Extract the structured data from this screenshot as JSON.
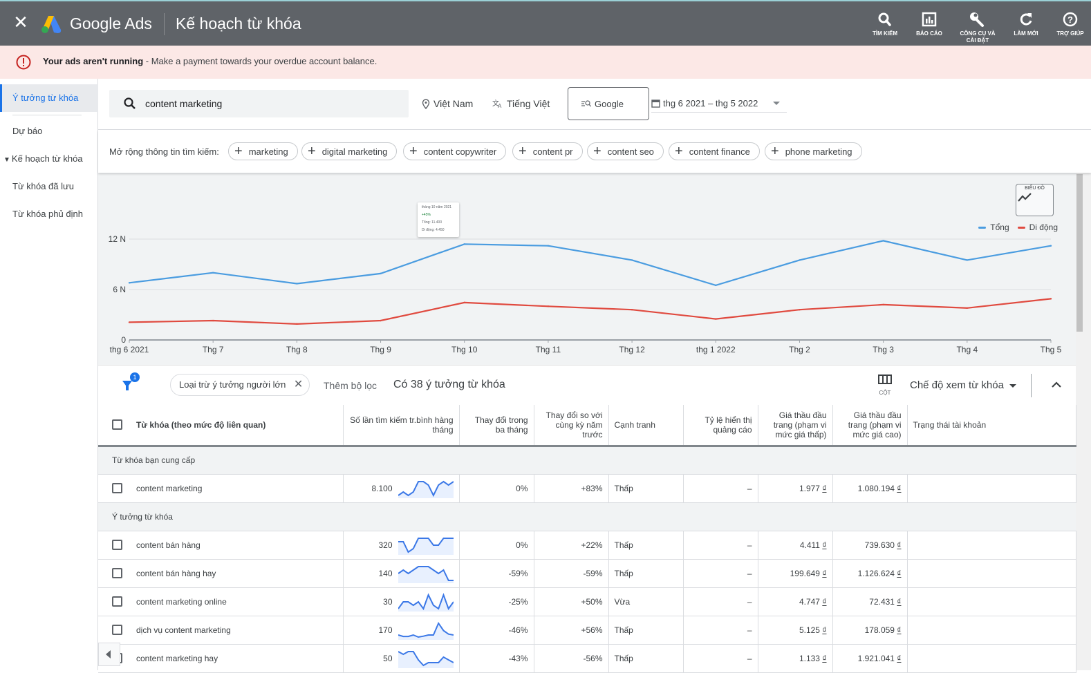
{
  "header": {
    "brand": "Google Ads",
    "title": "Kế hoạch từ khóa",
    "tools": [
      {
        "icon": "search-icon",
        "label": "TÌM KIẾM"
      },
      {
        "icon": "report-icon",
        "label": "BÁO CÁO"
      },
      {
        "icon": "wrench-icon",
        "label": "CÔNG CỤ VÀ CÀI ĐẶT"
      },
      {
        "icon": "refresh-icon",
        "label": "LÀM MỚI"
      },
      {
        "icon": "help-icon",
        "label": "TRỢ GIÚP"
      }
    ]
  },
  "alert": {
    "bold": "Your ads aren't running",
    "text": " - Make a payment towards your overdue account balance.",
    "color": "#c5221f"
  },
  "sidebar": {
    "items": [
      {
        "label": "Ý tưởng từ khóa",
        "active": true
      },
      {
        "label": "Dự báo"
      },
      {
        "label": "Kế hoạch từ khóa",
        "expandable": true
      },
      {
        "label": "Từ khóa đã lưu"
      },
      {
        "label": "Từ khóa phủ định"
      }
    ]
  },
  "search": {
    "value": "content marketing",
    "location": "Việt Nam",
    "language": "Tiếng Việt",
    "network": "Google",
    "date_range": "thg 6 2021 – thg 5 2022"
  },
  "refine": {
    "label": "Mở rộng thông tin tìm kiếm:",
    "chips": [
      "marketing",
      "digital marketing",
      "content copywriter",
      "content pr",
      "content seo",
      "content finance",
      "phone marketing"
    ]
  },
  "chart_toggle": {
    "label": "BIỂU ĐỒ"
  },
  "tooltip": {
    "title": "tháng 10 năm 2021",
    "change": "+45%",
    "total": "Tổng: 11.400",
    "mobile": "Di động: 4.450"
  },
  "chart_data": {
    "type": "line",
    "title": "",
    "xlabel": "",
    "ylabel": "",
    "categories": [
      "thg 6 2021",
      "Thg 7",
      "Thg 8",
      "Thg 9",
      "Thg 10",
      "Thg 11",
      "Thg 12",
      "thg 1 2022",
      "Thg 2",
      "Thg 3",
      "Thg 4",
      "Thg 5"
    ],
    "yticks": [
      {
        "value": 0,
        "label": "0"
      },
      {
        "value": 6000,
        "label": "6 N"
      },
      {
        "value": 12000,
        "label": "12 N"
      }
    ],
    "ylim": [
      0,
      12000
    ],
    "grid": true,
    "legend_position": "top-right",
    "series": [
      {
        "name": "Tổng",
        "color": "#4a9ce0",
        "values": [
          6800,
          8000,
          6700,
          7900,
          11400,
          11200,
          9500,
          6500,
          9500,
          11800,
          9500,
          11200
        ]
      },
      {
        "name": "Di động",
        "color": "#e04a3f",
        "values": [
          2100,
          2300,
          1900,
          2300,
          4450,
          4000,
          3600,
          2500,
          3600,
          4200,
          3800,
          4900
        ]
      }
    ]
  },
  "filterbar": {
    "badge": "1",
    "chip": "Loại trừ ý tưởng người lớn",
    "add_filter": "Thêm bộ lọc",
    "count": "Có 38 ý tưởng từ khóa",
    "columns_label": "CỘT",
    "view_mode": "Chế độ xem từ khóa"
  },
  "table": {
    "headers": [
      "Từ khóa (theo mức độ liên quan)",
      "Số lần tìm kiếm tr.bình hàng tháng",
      "Thay đổi trong ba tháng",
      "Thay đổi so với cùng kỳ năm trước",
      "Cạnh tranh",
      "Tỷ lệ hiển thị quảng cáo",
      "Giá thầu đầu trang (phạm vi mức giá thấp)",
      "Giá thầu đầu trang (phạm vi mức giá cao)",
      "Trạng thái tài khoản"
    ],
    "groups": [
      {
        "label": "Từ khóa bạn cung cấp",
        "rows": [
          {
            "keyword": "content marketing",
            "volume": "8.100",
            "trend": [
              2,
              3,
              2,
              3,
              6,
              6,
              5,
              2,
              5,
              6,
              5,
              6
            ],
            "three_month": "0%",
            "yoy": "+83%",
            "competition": "Thấp",
            "impr_share": "–",
            "bid_low": "1.977",
            "bid_high": "1.080.194",
            "status": ""
          }
        ]
      },
      {
        "label": "Ý tưởng từ khóa",
        "rows": [
          {
            "keyword": "content bán hàng",
            "volume": "320",
            "trend": [
              5,
              5,
              2,
              3,
              6,
              6,
              6,
              4,
              4,
              6,
              6,
              6
            ],
            "three_month": "0%",
            "yoy": "+22%",
            "competition": "Thấp",
            "impr_share": "–",
            "bid_low": "4.411",
            "bid_high": "739.630",
            "status": ""
          },
          {
            "keyword": "content bán hàng hay",
            "volume": "140",
            "trend": [
              4,
              5,
              4,
              5,
              6,
              6,
              6,
              5,
              4,
              5,
              2,
              2
            ],
            "three_month": "-59%",
            "yoy": "-59%",
            "competition": "Thấp",
            "impr_share": "–",
            "bid_low": "199.649",
            "bid_high": "1.126.624",
            "status": ""
          },
          {
            "keyword": "content marketing online",
            "volume": "30",
            "trend": [
              2,
              4,
              4,
              3,
              4,
              2,
              6,
              3,
              2,
              6,
              2,
              4
            ],
            "three_month": "-25%",
            "yoy": "+50%",
            "competition": "Vừa",
            "impr_share": "–",
            "bid_low": "4.747",
            "bid_high": "72.431",
            "status": ""
          },
          {
            "keyword": "dịch vụ content marketing",
            "volume": "170",
            "trend": [
              2,
              1.5,
              1.5,
              2,
              1.3,
              1.6,
              2,
              2,
              6,
              3.5,
              2.3,
              2
            ],
            "three_month": "-46%",
            "yoy": "+56%",
            "competition": "Thấp",
            "impr_share": "–",
            "bid_low": "5.125",
            "bid_high": "178.059",
            "status": ""
          },
          {
            "keyword": "content marketing hay",
            "volume": "50",
            "trend": [
              6,
              5,
              6,
              6,
              3,
              1,
              2,
              2,
              2,
              4,
              3,
              2
            ],
            "three_month": "-43%",
            "yoy": "-56%",
            "competition": "Thấp",
            "impr_share": "–",
            "bid_low": "1.133",
            "bid_high": "1.921.041",
            "status": ""
          }
        ]
      }
    ],
    "currency": "₫"
  }
}
